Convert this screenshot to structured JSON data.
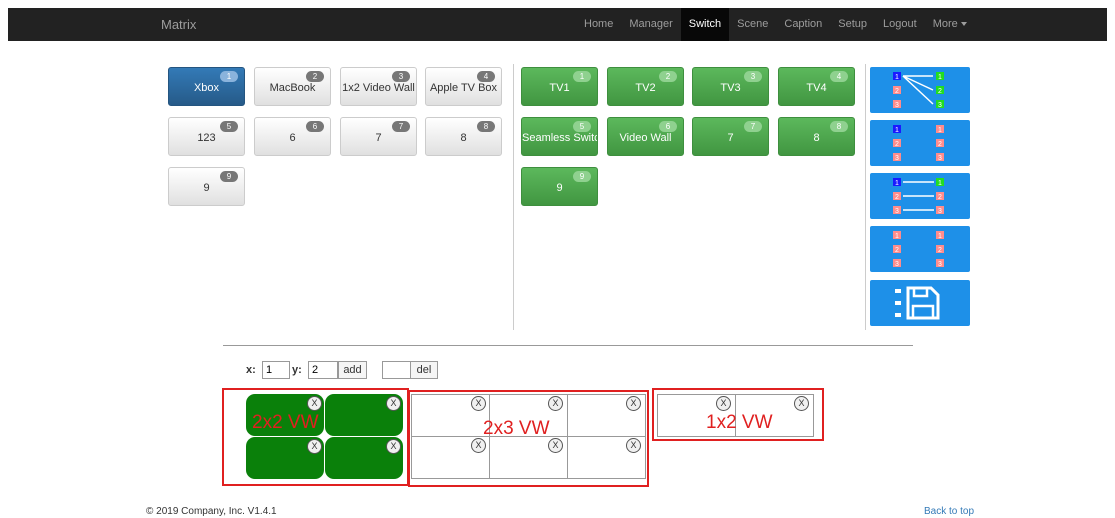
{
  "navbar": {
    "brand": "Matrix",
    "items": [
      "Home",
      "Manager",
      "Switch",
      "Scene",
      "Caption",
      "Setup",
      "Logout",
      "More"
    ]
  },
  "sources": [
    {
      "num": "1",
      "label": "Xbox",
      "selected": true
    },
    {
      "num": "2",
      "label": "MacBook"
    },
    {
      "num": "3",
      "label": "1x2 Video Wall"
    },
    {
      "num": "4",
      "label": "Apple TV Box"
    },
    {
      "num": "5",
      "label": "123"
    },
    {
      "num": "6",
      "label": "6"
    },
    {
      "num": "7",
      "label": "7"
    },
    {
      "num": "8",
      "label": "8"
    },
    {
      "num": "9",
      "label": "9"
    }
  ],
  "outputs": [
    {
      "num": "1",
      "label": "TV1"
    },
    {
      "num": "2",
      "label": "TV2"
    },
    {
      "num": "3",
      "label": "TV3"
    },
    {
      "num": "4",
      "label": "TV4"
    },
    {
      "num": "5",
      "label": "Seamless Switch"
    },
    {
      "num": "6",
      "label": "Video Wall"
    },
    {
      "num": "7",
      "label": "7"
    },
    {
      "num": "8",
      "label": "8"
    },
    {
      "num": "9",
      "label": "9"
    }
  ],
  "side_buttons": [
    "all-to-one-icon",
    "clear-all-icon",
    "one-to-one-icon",
    "disconnect-icon",
    "save-icon"
  ],
  "wall_controls": {
    "x_label": "x:",
    "x_value": "1",
    "y_label": "y:",
    "y_value": "2",
    "add_label": "add",
    "del_value": "",
    "del_label": "del"
  },
  "close_glyph": "X",
  "annotations": {
    "wall1": "2x2 VW",
    "wall2": "2x3 VW",
    "wall3": "1x2 VW"
  },
  "footer": {
    "copyright": "© 2019 Company, Inc. V1.4.1",
    "back_to_top": "Back to top"
  },
  "colors": {
    "selected_source": "#337ab7",
    "output": "#5cb85c",
    "side_button": "#1e90e8",
    "wall_active": "#0a800a",
    "annotation": "#e02020"
  }
}
